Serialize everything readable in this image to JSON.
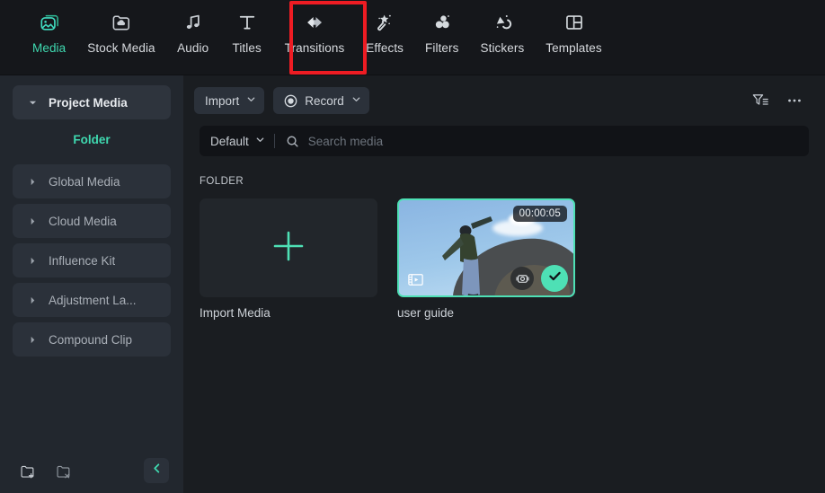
{
  "tabbar": {
    "tabs": [
      {
        "label": "Media",
        "icon": "image-in-frame-icon",
        "active": true
      },
      {
        "label": "Stock Media",
        "icon": "folder-cloud-icon",
        "active": false
      },
      {
        "label": "Audio",
        "icon": "music-note-icon",
        "active": false
      },
      {
        "label": "Titles",
        "icon": "text-t-icon",
        "active": false
      },
      {
        "label": "Transitions",
        "icon": "transition-arrows-icon",
        "active": false
      },
      {
        "label": "Effects",
        "icon": "magic-wand-icon",
        "active": false
      },
      {
        "label": "Filters",
        "icon": "three-circles-icon",
        "active": false
      },
      {
        "label": "Stickers",
        "icon": "stickers-shapes-icon",
        "active": false
      },
      {
        "label": "Templates",
        "icon": "layout-grid-icon",
        "active": false
      }
    ],
    "highlight_tab": "Transitions",
    "highlight_color": "#ee1c23"
  },
  "sidebar": {
    "items": [
      {
        "label": "Project Media",
        "caret": "caret-down",
        "selected": true,
        "type": "group"
      },
      {
        "label": "Folder",
        "caret": "",
        "selected": false,
        "type": "child"
      },
      {
        "label": "Global Media",
        "caret": "caret-right",
        "selected": false,
        "type": "group"
      },
      {
        "label": "Cloud Media",
        "caret": "caret-right",
        "selected": false,
        "type": "group"
      },
      {
        "label": "Influence Kit",
        "caret": "caret-right",
        "selected": false,
        "type": "group"
      },
      {
        "label": "Adjustment La...",
        "caret": "caret-right",
        "selected": false,
        "type": "group"
      },
      {
        "label": "Compound Clip",
        "caret": "caret-right",
        "selected": false,
        "type": "group"
      }
    ],
    "footer": {
      "new_folder_icon": "folder-plus-icon",
      "delete_folder_icon": "folder-delete-icon",
      "collapse_icon": "chevron-left-icon"
    },
    "accent_color": "#3fd9b0"
  },
  "toolbar": {
    "import_label": "Import",
    "record_label": "Record",
    "filter_icon": "filter-sort-icon",
    "more_icon": "more-horizontal-icon"
  },
  "search": {
    "sort_label": "Default",
    "placeholder": "Search media",
    "value": "",
    "search_icon": "search-icon"
  },
  "content": {
    "section_label": "FOLDER",
    "cards": [
      {
        "caption": "Import Media",
        "kind": "import",
        "plus_icon": "plus-icon",
        "plus_color": "#4ee0b5"
      },
      {
        "caption": "user guide",
        "kind": "video",
        "duration": "00:00:05",
        "selected": true,
        "film_icon": "film-strip-icon",
        "camera_icon": "camera-stabilize-icon",
        "check_icon": "check-icon",
        "border_color": "#4ee0b5"
      }
    ]
  }
}
